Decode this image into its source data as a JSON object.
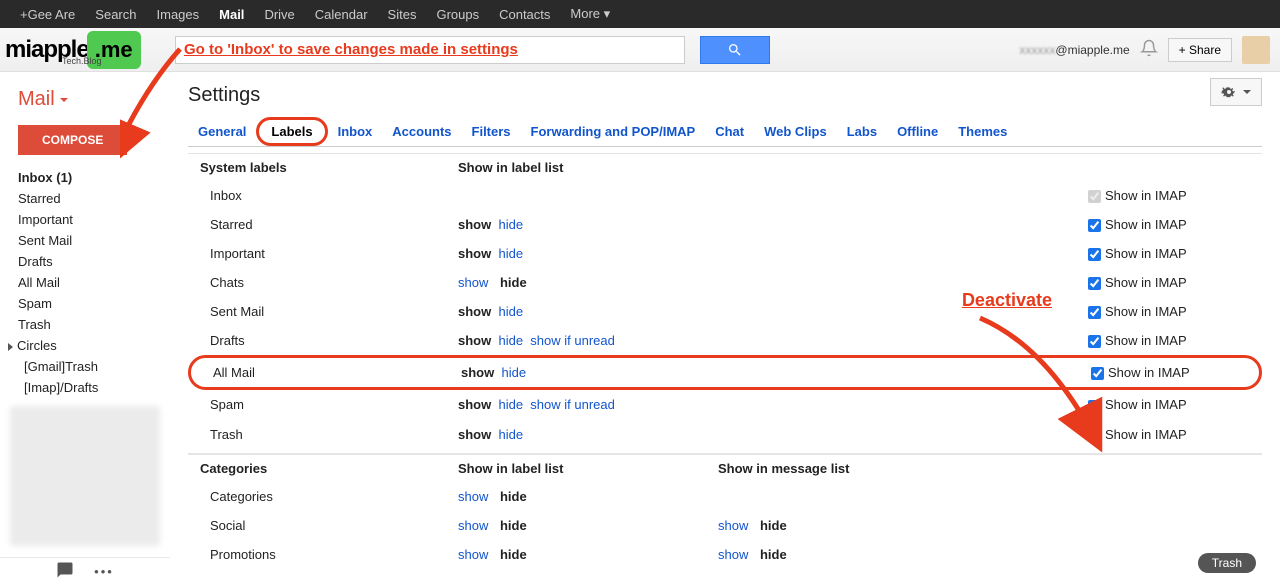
{
  "topnav": {
    "items": [
      "+Gee Are",
      "Search",
      "Images",
      "Mail",
      "Drive",
      "Calendar",
      "Sites",
      "Groups",
      "Contacts",
      "More"
    ],
    "activeIndex": 3
  },
  "logo": {
    "main": "miapple",
    "me": ".me",
    "sub": "Tech.Blog"
  },
  "searchAnnotation": "Go to 'Inbox' to save changes made in settings",
  "header": {
    "emailBlur": "xxxxxx",
    "emailSuffix": "@miapple.me",
    "shareLabel": "+ Share"
  },
  "sidebar": {
    "mailLabel": "Mail",
    "compose": "COMPOSE",
    "items": [
      {
        "label": "Inbox (1)",
        "bold": true
      },
      {
        "label": "Starred"
      },
      {
        "label": "Important"
      },
      {
        "label": "Sent Mail"
      },
      {
        "label": "Drafts"
      },
      {
        "label": "All Mail"
      },
      {
        "label": "Spam"
      },
      {
        "label": "Trash"
      },
      {
        "label": "Circles",
        "caret": true
      },
      {
        "label": "[Gmail]Trash",
        "sub": true
      },
      {
        "label": "[Imap]/Drafts",
        "sub": true
      }
    ]
  },
  "settingsTitle": "Settings",
  "tabs": [
    "General",
    "Labels",
    "Inbox",
    "Accounts",
    "Filters",
    "Forwarding and POP/IMAP",
    "Chat",
    "Web Clips",
    "Labs",
    "Offline",
    "Themes"
  ],
  "activeTab": 1,
  "sysHeader": {
    "c1": "System labels",
    "c2": "Show in label list"
  },
  "imapLabel": "Show in IMAP",
  "sysRows": [
    {
      "name": "Inbox",
      "c2": "",
      "imapChecked": true,
      "imapDisabled": true
    },
    {
      "name": "Starred",
      "c2": "show-hide",
      "imapChecked": true
    },
    {
      "name": "Important",
      "c2": "show-hide",
      "imapChecked": true
    },
    {
      "name": "Chats",
      "c2": "link-show-hide",
      "imapChecked": true
    },
    {
      "name": "Sent Mail",
      "c2": "show-hide",
      "imapChecked": true
    },
    {
      "name": "Drafts",
      "c2": "show-hide-unread",
      "imapChecked": true
    },
    {
      "name": "All Mail",
      "c2": "show-hide",
      "imapChecked": true,
      "highlight": true
    },
    {
      "name": "Spam",
      "c2": "show-hide-unread",
      "imapChecked": true
    },
    {
      "name": "Trash",
      "c2": "show-hide",
      "imapChecked": true
    }
  ],
  "catHeader": {
    "c1": "Categories",
    "c2": "Show in label list",
    "c3": "Show in message list"
  },
  "catRows": [
    {
      "name": "Categories",
      "c2": "link-show-hide",
      "c3": ""
    },
    {
      "name": "Social",
      "c2": "link-show-hide",
      "c3": "link-show-hide"
    },
    {
      "name": "Promotions",
      "c2": "link-show-hide",
      "c3": "link-show-hide"
    }
  ],
  "words": {
    "show": "show",
    "hide": "hide",
    "showIfUnread": "show if unread"
  },
  "deactivateAnno": "Deactivate",
  "trashPill": "Trash"
}
